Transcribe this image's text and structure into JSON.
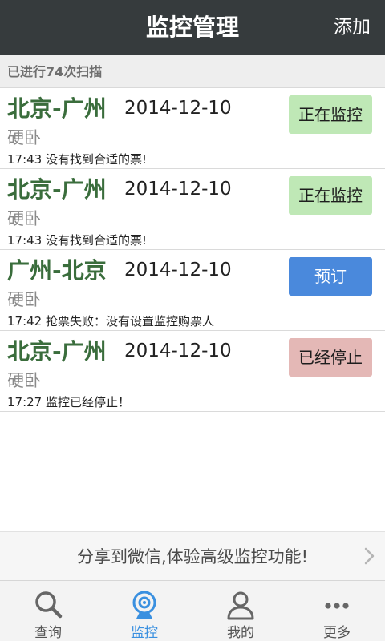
{
  "header": {
    "title": "监控管理",
    "add_label": "添加"
  },
  "scan_info": "已进行74次扫描",
  "tickets": [
    {
      "route": "北京-广州",
      "date": "2014-12-10",
      "seat": "硬卧",
      "status": "17:43 没有找到合适的票!",
      "action": "正在监控",
      "action_type": "monitoring"
    },
    {
      "route": "北京-广州",
      "date": "2014-12-10",
      "seat": "硬卧",
      "status": "17:43 没有找到合适的票!",
      "action": "正在监控",
      "action_type": "monitoring"
    },
    {
      "route": "广州-北京",
      "date": "2014-12-10",
      "seat": "硬卧",
      "status": "17:42 抢票失败：没有设置监控购票人",
      "action": "预订",
      "action_type": "book"
    },
    {
      "route": "北京-广州",
      "date": "2014-12-10",
      "seat": "硬卧",
      "status": "17:27 监控已经停止！",
      "action": "已经停止",
      "action_type": "stopped"
    }
  ],
  "share_banner": "分享到微信,体验高级监控功能!",
  "tabs": [
    {
      "label": "查询",
      "icon": "search-icon"
    },
    {
      "label": "监控",
      "icon": "monitor-camera-icon",
      "active": true
    },
    {
      "label": "我的",
      "icon": "user-icon"
    },
    {
      "label": "更多",
      "icon": "more-dots-icon"
    }
  ],
  "colors": {
    "header_bg": "#363b3d",
    "route_green": "#3a6d3c",
    "monitoring_btn": "#bfe8b6",
    "book_btn": "#4a89dc",
    "stopped_btn": "#e4b8b6",
    "active_tab": "#3a90e0"
  }
}
